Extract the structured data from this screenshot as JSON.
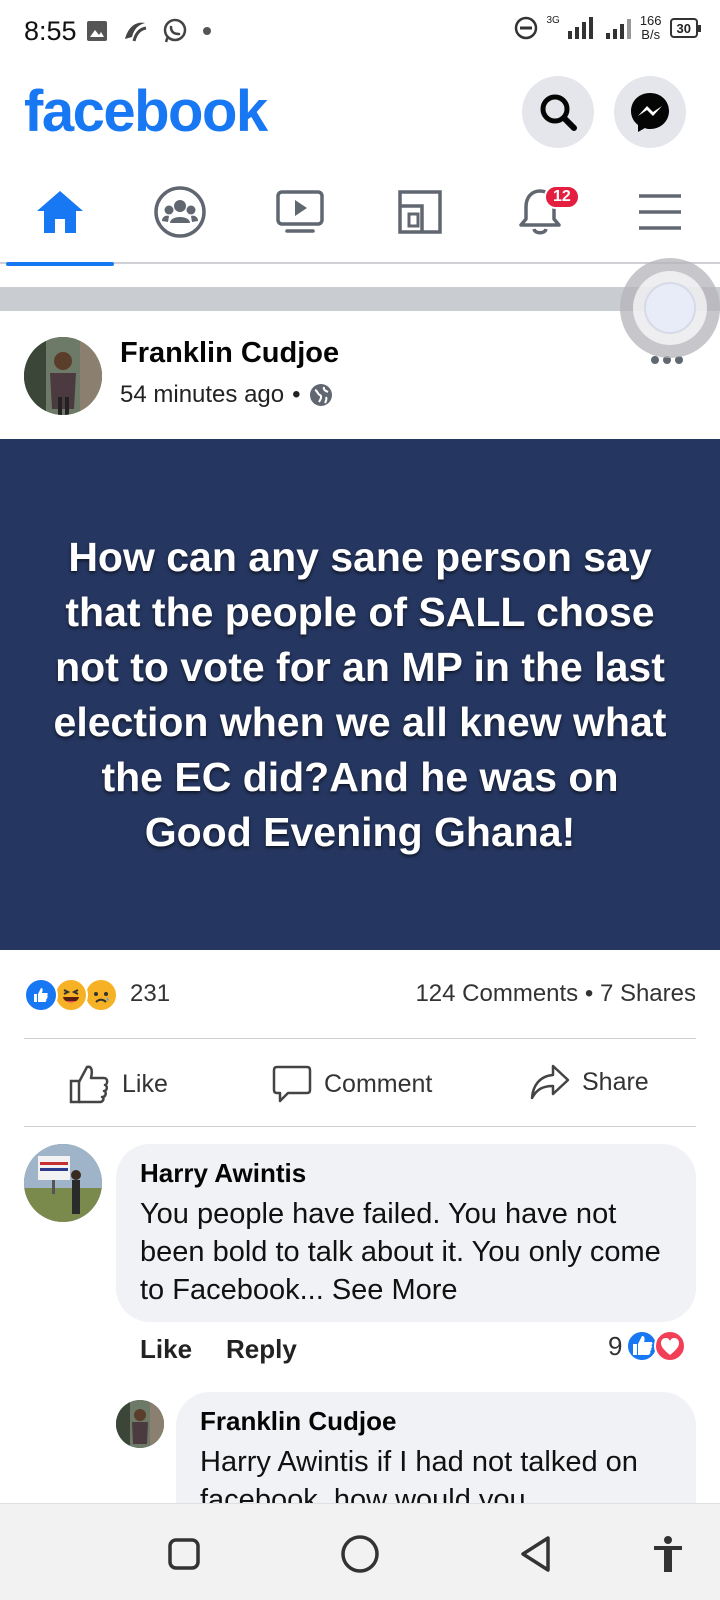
{
  "status_bar": {
    "time": "8:55",
    "network_speed_value": "166",
    "network_speed_unit": "B/s",
    "battery": "30",
    "network_type": "3G"
  },
  "header": {
    "logo": "facebook"
  },
  "nav": {
    "notifications_badge": "12"
  },
  "post": {
    "author": "Franklin Cudjoe",
    "time": "54 minutes ago",
    "separator": "•",
    "text": "How can any sane person say that the people of SALL chose not to vote for an MP in the last election when we all knew what the EC did?And he was on Good Evening Ghana!",
    "background_color": "#253660",
    "reactions_count": "231",
    "comments": "124 Comments",
    "shares": "7 Shares",
    "stats_separator": "•",
    "actions": {
      "like": "Like",
      "comment": "Comment",
      "share": "Share"
    }
  },
  "comments": [
    {
      "author": "Harry Awintis",
      "text": "You people have failed. You have not been bold to talk about it. You only come to Facebook... See More",
      "like_label": "Like",
      "reply_label": "Reply",
      "reactions": "9"
    },
    {
      "author": "Franklin Cudjoe",
      "text": "Harry Awintis if I had not talked on facebook, how would you"
    }
  ],
  "colors": {
    "brand": "#1877f2",
    "badge": "#e41e3f"
  }
}
